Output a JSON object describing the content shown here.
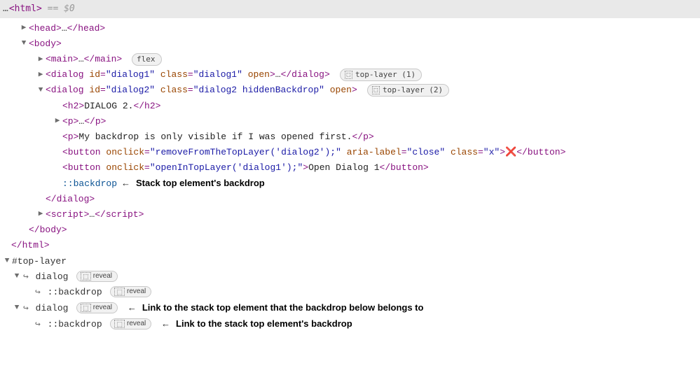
{
  "header": {
    "dots": "…",
    "html_open": "<html>",
    "selection_marker": "== $0"
  },
  "arrows": {
    "right": "▶",
    "down": "▼"
  },
  "ellipsis": "…",
  "tags": {
    "head_open": "<head>",
    "head_close": "</head>",
    "body_open": "<body>",
    "body_close": "</body>",
    "main_open": "<main>",
    "main_close": "</main>",
    "script_open": "<script>",
    "script_close": "</script>",
    "html_close": "</html>",
    "h2_open": "<h2>",
    "h2_close": "</h2>",
    "p_open": "<p>",
    "p_close": "</p>",
    "button_close": "</button>",
    "dialog_close": "</dialog>"
  },
  "main_badge": "flex",
  "dialog1": {
    "raw_open": "<dialog ",
    "id_name": "id",
    "id_val": "\"dialog1\"",
    "class_name": "class",
    "class_val": "\"dialog1\"",
    "open_attr": "open",
    "close_bracket": ">",
    "close_tag": "</dialog>",
    "badge_label": "top-layer (1)"
  },
  "dialog2": {
    "raw_open": "<dialog ",
    "id_name": "id",
    "id_val": "\"dialog2\"",
    "class_name": "class",
    "class_val": "\"dialog2 hiddenBackdrop\"",
    "open_attr": "open",
    "close_bracket": ">",
    "badge_label": "top-layer (2)",
    "h2_text": "DIALOG 2.",
    "p2_text": "My backdrop is only visible if I was opened first.",
    "btn1_onclick_name": "onclick",
    "btn1_onclick_val": "\"removeFromTheTopLayer('dialog2');\"",
    "btn1_aria_name": "aria-label",
    "btn1_aria_val": "\"close\"",
    "btn1_class_name": "class",
    "btn1_class_val": "\"x\"",
    "btn1_open": "<button ",
    "btn1_close_bracket": ">",
    "btn1_text": "❌",
    "btn2_open": "<button ",
    "btn2_onclick_name": "onclick",
    "btn2_onclick_val": "\"openInTopLayer('dialog1');\"",
    "btn2_close_bracket": ">",
    "btn2_text": "Open Dialog 1",
    "backdrop_pseudo": "::backdrop",
    "backdrop_annotation": "Stack top element's backdrop"
  },
  "toplayer": {
    "label": "#top-layer",
    "dialog_label": "dialog",
    "backdrop_label": "::backdrop",
    "reveal_label": "reveal",
    "annot1": "Link to the stack top element that the backdrop below belongs to",
    "annot2": "Link to the stack top element's backdrop"
  },
  "link_arrow_char": "↪",
  "left_arrow": "←"
}
